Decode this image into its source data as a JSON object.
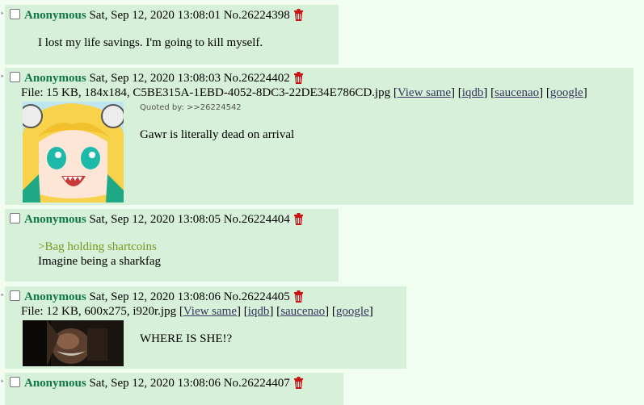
{
  "posts": [
    {
      "name": "Anonymous",
      "datetime": "Sat, Sep 12, 2020 13:08:01",
      "number": "No.26224398",
      "lines": [
        "I lost my life savings. I'm going to kill myself."
      ]
    },
    {
      "name": "Anonymous",
      "datetime": "Sat, Sep 12, 2020 13:08:03",
      "number": "No.26224402",
      "file_prefix": "File: 15 KB, 184x184, C5BE315A-1EBD-4052-8DC3-22DE34E786CD.jpg",
      "quoted_by": "Quoted by: >>26224542",
      "lines": [
        "Gawr is literally dead on arrival"
      ]
    },
    {
      "name": "Anonymous",
      "datetime": "Sat, Sep 12, 2020 13:08:05",
      "number": "No.26224404",
      "greentext": ">Bag holding shartcoins",
      "lines": [
        "Imagine being a sharkfag"
      ]
    },
    {
      "name": "Anonymous",
      "datetime": "Sat, Sep 12, 2020 13:08:06",
      "number": "No.26224405",
      "file_prefix": "File: 12 KB, 600x275, i920r.jpg",
      "lines": [
        "WHERE IS SHE!?"
      ]
    },
    {
      "name": "Anonymous",
      "datetime": "Sat, Sep 12, 2020 13:08:06",
      "number": "No.26224407"
    }
  ],
  "file_links": {
    "view_same": "View same",
    "iqdb": "iqdb",
    "saucenao": "saucenao",
    "google": "google"
  },
  "colors": {
    "page_bg": "#f0fdf0",
    "post_bg": "#d6f0d9",
    "name": "#117743",
    "greentext": "#789922",
    "link": "#34345c",
    "delete_icon": "#cc1111"
  },
  "icons": {
    "delete": "trash-icon",
    "anime_thumb": "anime-girl-thumbnail",
    "dark_thumb": "dark-face-thumbnail"
  }
}
